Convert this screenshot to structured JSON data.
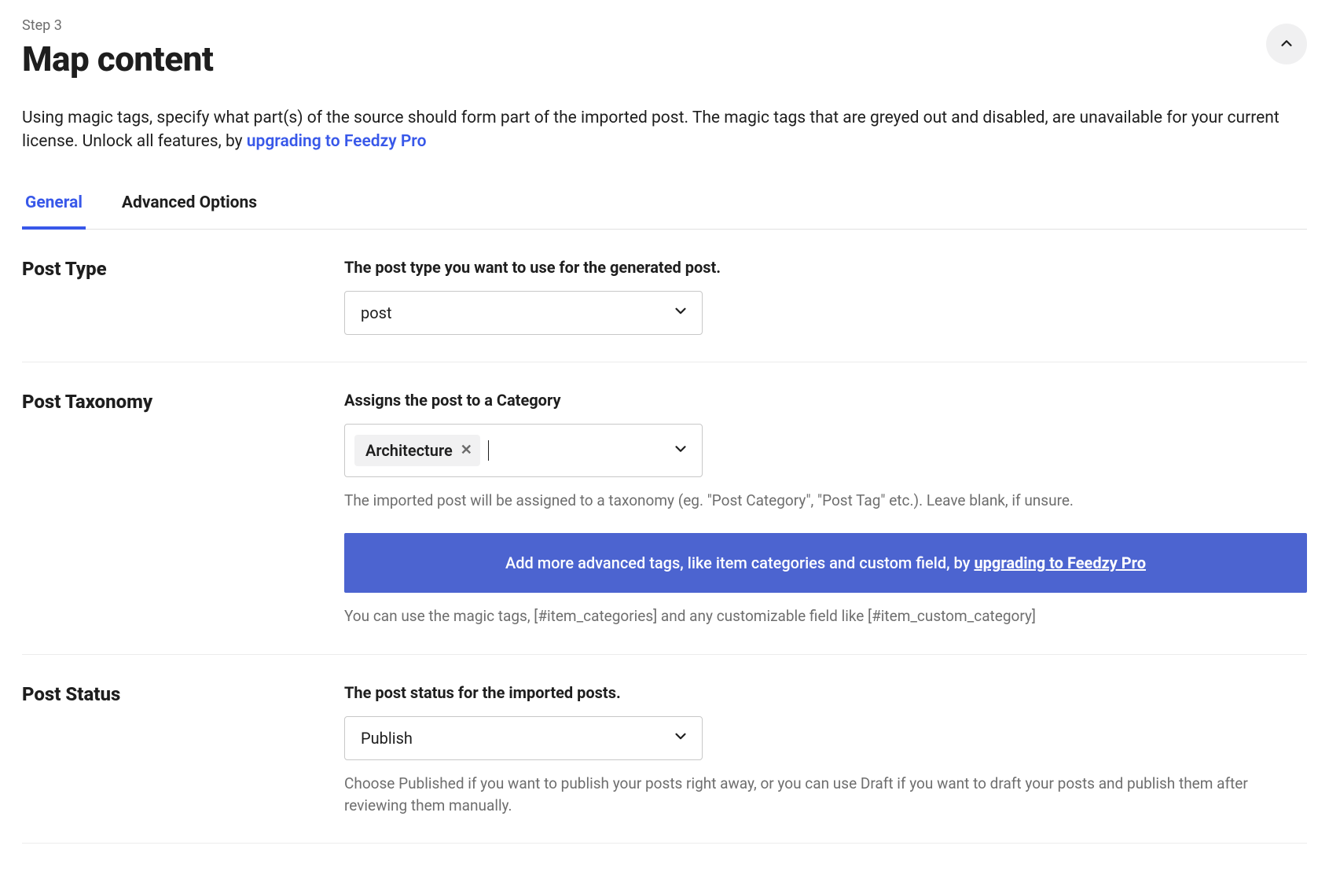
{
  "header": {
    "step_label": "Step 3",
    "title": "Map content"
  },
  "intro": {
    "text_before_link": "Using magic tags, specify what part(s) of the source should form part of the imported post. The magic tags that are greyed out and disabled, are unavailable for your current license. Unlock all features, by ",
    "link_text": "upgrading to Feedzy Pro"
  },
  "tabs": {
    "general": "General",
    "advanced": "Advanced Options"
  },
  "post_type": {
    "section_title": "Post Type",
    "label": "The post type you want to use for the generated post.",
    "value": "post"
  },
  "post_taxonomy": {
    "section_title": "Post Taxonomy",
    "label": "Assigns the post to a Category",
    "selected_tag": "Architecture",
    "help": "The imported post will be assigned to a taxonomy (eg. \"Post Category\", \"Post Tag\" etc.). Leave blank, if unsure.",
    "promo_before": "Add more advanced tags, like item categories and custom field, by ",
    "promo_link": "upgrading to Feedzy Pro",
    "promo_help": "You can use the magic tags, [#item_categories] and any customizable field like [#item_custom_category]"
  },
  "post_status": {
    "section_title": "Post Status",
    "label": "The post status for the imported posts.",
    "value": "Publish",
    "help": "Choose Published if you want to publish your posts right away, or you can use Draft if you want to draft your posts and publish them after reviewing them manually."
  }
}
